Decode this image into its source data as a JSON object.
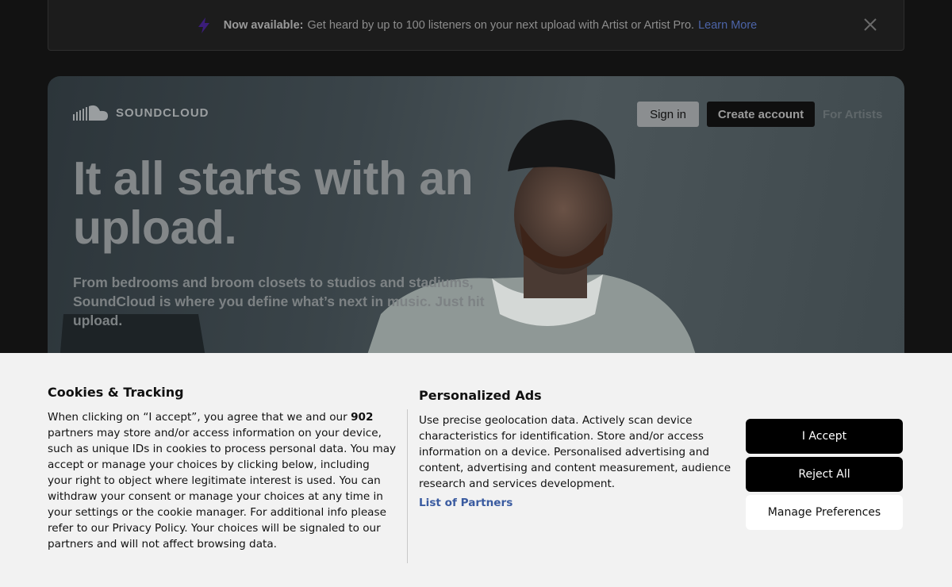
{
  "banner": {
    "bolt_icon": "lightning-bolt-icon",
    "bolt_color": "#3b1d7a",
    "strong": "Now available:",
    "text": "Get heard by up to 100 listeners on your next upload with Artist or Artist Pro.",
    "link": "Learn More",
    "close_icon": "close-icon"
  },
  "hero": {
    "logo_text": "SOUNDCLOUD",
    "logo_icon": "soundcloud-cloud-icon",
    "signin": "Sign in",
    "create_account": "Create account",
    "for_artists": "For Artists",
    "headline": "It all starts with an upload.",
    "subtext": "From bedrooms and broom closets to studios and stadiums, SoundCloud is where you define what’s next in music. Just hit upload."
  },
  "consent": {
    "title": "Cookies & Tracking",
    "body_pre": "When clicking on “I accept”, you agree that we and our",
    "partner_count": "902",
    "body_post": "partners may store and/or access information on your device, such as unique IDs in cookies to process personal data. You may accept or manage your choices by clicking below, including your right to object where legitimate interest is used. You can withdraw your consent or manage your choices at any time in your settings or the cookie manager. For additional info please refer to our Privacy Policy. Your choices will be signaled to our partners and will not affect browsing data.",
    "ads_title": "Personalized Ads",
    "ads_body": "Use precise geolocation data. Actively scan device characteristics for identification. Store and/or access information on a device. Personalised advertising and content, advertising and content measurement, audience research and services development.",
    "partners_link": "List of Partners",
    "accept": "I Accept",
    "reject": "Reject All",
    "manage": "Manage Preferences"
  }
}
